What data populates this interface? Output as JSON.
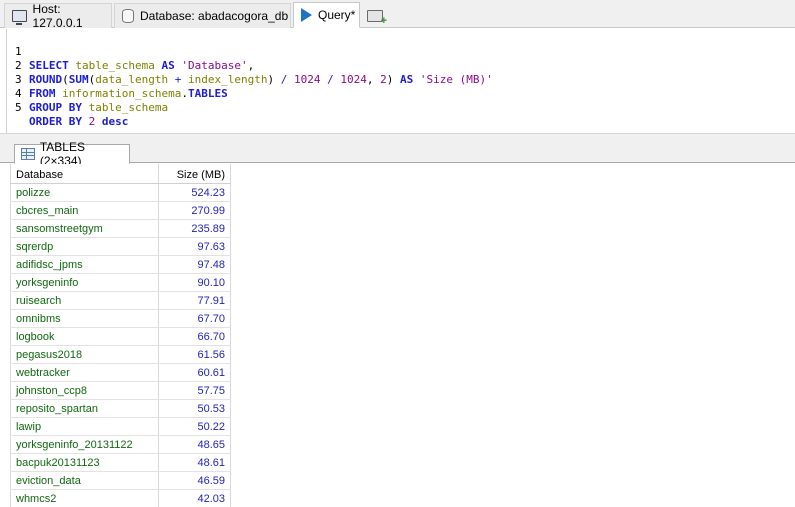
{
  "tabs": {
    "host_label": "Host: 127.0.0.1",
    "database_label": "Database: abadacogora_db",
    "query_label": "Query*"
  },
  "editor": {
    "lines": [
      {
        "num": "1"
      },
      {
        "num": "2"
      },
      {
        "num": "3"
      },
      {
        "num": "4"
      },
      {
        "num": "5"
      }
    ],
    "tokens": {
      "l1_select": "SELECT",
      "l1_col": "table_schema",
      "l1_as": "AS",
      "l1_str": "'Database'",
      "l1_comma": ",",
      "l2_round": "ROUND",
      "l2_p1": "(",
      "l2_sum": "SUM",
      "l2_p2": "(",
      "l2_a": "data_length",
      "l2_plus": " + ",
      "l2_b": "index_length",
      "l2_p3": ")",
      "l2_div1": " / ",
      "l2_n1": "1024",
      "l2_div2": " / ",
      "l2_n2": "1024",
      "l2_comma": ", ",
      "l2_n3": "2",
      "l2_p4": ")",
      "l2_as": "AS",
      "l2_str": "'Size (MB)'",
      "l3_from": "FROM",
      "l3_schema": "information_schema",
      "l3_dot": ".",
      "l3_tables": "TABLES",
      "l4_group": "GROUP BY",
      "l4_col": "table_schema",
      "l5_order": "ORDER BY",
      "l5_n": "2",
      "l5_desc": "desc"
    }
  },
  "result": {
    "tab_label": "TABLES (2×334)",
    "columns": [
      "Database",
      "Size (MB)"
    ],
    "rows": [
      [
        "polizze",
        "524.23"
      ],
      [
        "cbcres_main",
        "270.99"
      ],
      [
        "sansomstreetgym",
        "235.89"
      ],
      [
        "sqrerdp",
        "97.63"
      ],
      [
        "adifidsc_jpms",
        "97.48"
      ],
      [
        "yorksgeninfo",
        "90.10"
      ],
      [
        "ruisearch",
        "77.91"
      ],
      [
        "omnibms",
        "67.70"
      ],
      [
        "logbook",
        "66.70"
      ],
      [
        "pegasus2018",
        "61.56"
      ],
      [
        "webtracker",
        "60.61"
      ],
      [
        "johnston_ccp8",
        "57.75"
      ],
      [
        "reposito_spartan",
        "50.53"
      ],
      [
        "lawip",
        "50.22"
      ],
      [
        "yorksgeninfo_20131122",
        "48.65"
      ],
      [
        "bacpuk20131123",
        "48.61"
      ],
      [
        "eviction_data",
        "46.59"
      ],
      [
        "whmcs2",
        "42.03"
      ]
    ]
  }
}
